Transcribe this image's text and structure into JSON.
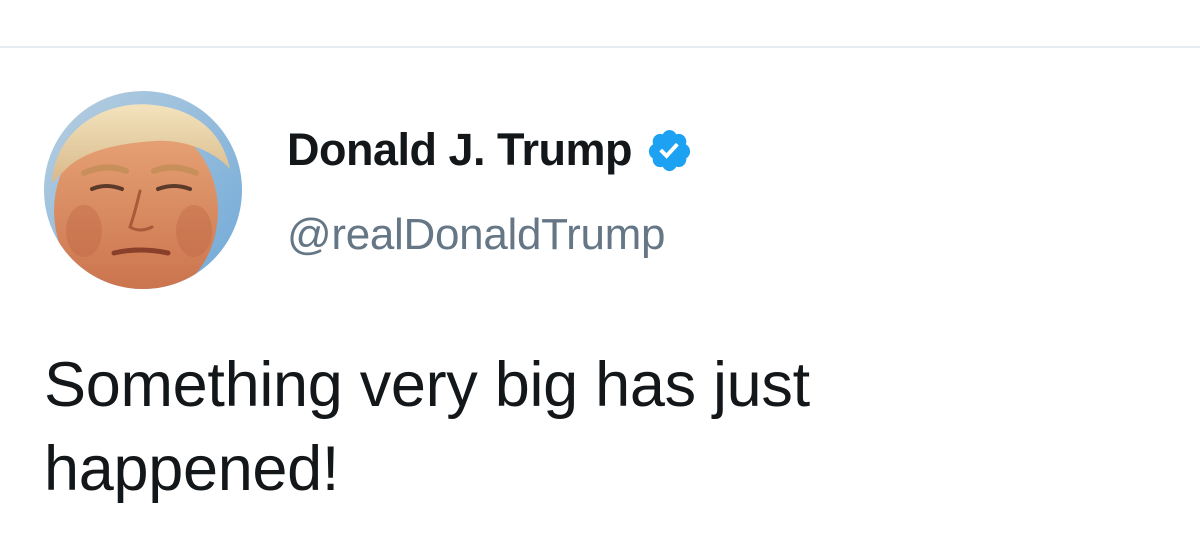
{
  "tweet": {
    "author": {
      "display_name": "Donald J. Trump",
      "handle": "@realDonaldTrump",
      "verified": true,
      "avatar_icon": "profile-photo"
    },
    "text": "Something very big has just\nhappened!"
  },
  "colors": {
    "name": "#14171a",
    "handle": "#657786",
    "verified_badge": "#1da1f2",
    "divider": "#e6ecf0",
    "background": "#ffffff"
  }
}
